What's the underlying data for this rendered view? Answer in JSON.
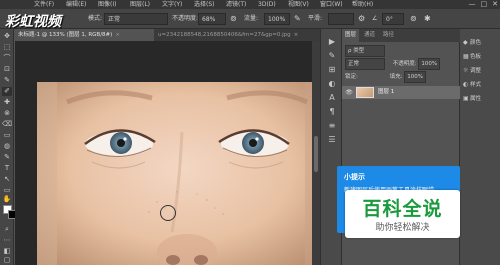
{
  "app": {
    "accent_color": "#1c8ae6",
    "watermark_logo": "彩虹视频"
  },
  "menubar": {
    "items": [
      "文件(F)",
      "编辑(E)",
      "图像(I)",
      "图层(L)",
      "文字(Y)",
      "选择(S)",
      "滤镜(T)",
      "3D(D)",
      "视图(V)",
      "窗口(W)",
      "帮助(H)"
    ],
    "window_controls": [
      "—",
      "□",
      "✕"
    ]
  },
  "options_bar": {
    "blend_mode_label": "模式:",
    "blend_mode_value": "正常",
    "opacity_label": "不透明度:",
    "opacity_value": "68%",
    "flow_label": "流量:",
    "flow_value": "100%",
    "smoothing_label": "平滑:",
    "smoothing_value": "",
    "angle_label": "∠",
    "angle_value": "0°"
  },
  "document_tabs": [
    {
      "label": "未标题-1 @ 133% (图层 1, RGB/8#)",
      "close": "×",
      "active": true
    },
    {
      "label": "u=2342188548,2168850406&fm=27&gp=0.jpg",
      "close": "×",
      "active": false
    }
  ],
  "toolbox": {
    "tools": [
      "✥",
      "⬚",
      "⌒",
      "⊡",
      "✎",
      "✐",
      "✚",
      "⊗",
      "⌫",
      "▭",
      "◍",
      "✎",
      "T",
      "↖",
      "▭",
      "✋",
      "⌕",
      "⋯",
      "◧",
      "▢"
    ],
    "foreground_color": "#ffffff",
    "background_color": "#000000"
  },
  "side_strip": {
    "icons": [
      "▶",
      "✎",
      "⊞",
      "◐",
      "A",
      "¶",
      "≡",
      "☰"
    ]
  },
  "layers_panel": {
    "tabs": [
      "图层",
      "通道",
      "路径"
    ],
    "filter_label": "ρ 类型",
    "blend_mode": "正常",
    "opacity_label": "不透明度:",
    "opacity_value": "100%",
    "lock_label": "锁定:",
    "fill_label": "填充:",
    "fill_value": "100%",
    "layers": [
      {
        "name": "图层 1",
        "visible": true
      }
    ]
  },
  "callout": {
    "title": "小提示",
    "body": "新建图层后使用画笔工具涂抹眼袋"
  },
  "right_panel": {
    "items": [
      {
        "icon": "◆",
        "label": "颜色"
      },
      {
        "icon": "▦",
        "label": "色板"
      },
      {
        "icon": "☼",
        "label": "调整"
      },
      {
        "icon": "◐",
        "label": "样式"
      },
      {
        "icon": "▣",
        "label": "属性"
      }
    ]
  },
  "baike_badge": {
    "title": "百科全说",
    "subtitle": "助你轻松解决"
  }
}
